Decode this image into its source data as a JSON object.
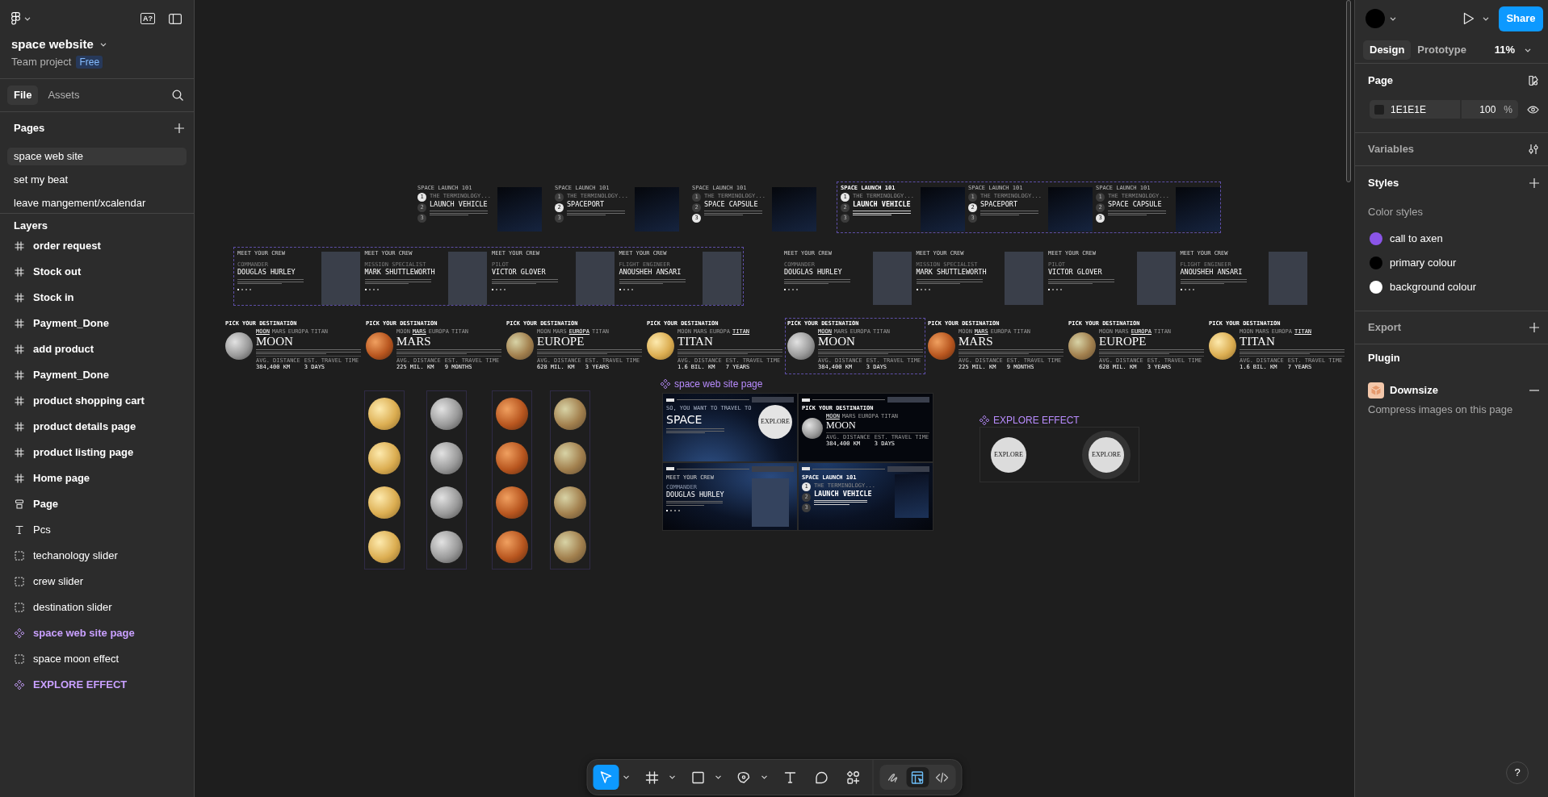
{
  "header": {
    "ai_label": "A?",
    "file_name": "space website",
    "project": "Team project",
    "plan": "Free"
  },
  "left_tabs": [
    {
      "label": "File",
      "selected": true
    },
    {
      "label": "Assets",
      "selected": false
    }
  ],
  "pages": {
    "title": "Pages",
    "items": [
      {
        "label": "space web site",
        "selected": true
      },
      {
        "label": "set my beat",
        "selected": false
      },
      {
        "label": "leave mangement/xcalendar",
        "selected": false
      }
    ]
  },
  "layers": {
    "title": "Layers",
    "items": [
      {
        "kind": "frame",
        "label": "order request"
      },
      {
        "kind": "frame",
        "label": "Stock out"
      },
      {
        "kind": "frame",
        "label": "Stock in"
      },
      {
        "kind": "frame",
        "label": "Payment_Done"
      },
      {
        "kind": "frame",
        "label": "add product"
      },
      {
        "kind": "frame",
        "label": "Payment_Done"
      },
      {
        "kind": "frame",
        "label": "product shopping cart"
      },
      {
        "kind": "frame",
        "label": "product details page"
      },
      {
        "kind": "frame",
        "label": "product listing page"
      },
      {
        "kind": "frame",
        "label": "Home page"
      },
      {
        "kind": "section",
        "label": "Page"
      },
      {
        "kind": "text",
        "label": "Pcs"
      },
      {
        "kind": "group",
        "label": "techanology slider"
      },
      {
        "kind": "group",
        "label": "crew slider"
      },
      {
        "kind": "group",
        "label": "destination slider"
      },
      {
        "kind": "component",
        "label": "space web site page"
      },
      {
        "kind": "group",
        "label": "space moon effect"
      },
      {
        "kind": "component",
        "label": "EXPLORE EFFECT"
      }
    ]
  },
  "canvas": {
    "tech_slider": {
      "groups": [
        {
          "slides": [
            {
              "heading": "SPACE LAUNCH 101",
              "eyebrow": "THE TERMINOLOGY...",
              "title": "LAUNCH VEHICLE",
              "steps": [
                {
                  "label": "1",
                  "selected": true
                },
                {
                  "label": "2",
                  "selected": false
                },
                {
                  "label": "3",
                  "selected": false
                }
              ]
            },
            {
              "heading": "SPACE LAUNCH 101",
              "eyebrow": "THE TERMINOLOGY...",
              "title": "SPACEPORT",
              "steps": [
                {
                  "label": "1",
                  "selected": false
                },
                {
                  "label": "2",
                  "selected": true
                },
                {
                  "label": "3",
                  "selected": false
                }
              ]
            },
            {
              "heading": "SPACE LAUNCH 101",
              "eyebrow": "THE TERMINOLOGY...",
              "title": "SPACE CAPSULE",
              "steps": [
                {
                  "label": "1",
                  "selected": false
                },
                {
                  "label": "2",
                  "selected": false
                },
                {
                  "label": "3",
                  "selected": true
                }
              ]
            }
          ]
        },
        {
          "outlined": true,
          "slides": [
            {
              "heading": "SPACE LAUNCH 101",
              "eyebrow": "THE TERMINOLOGY...",
              "title": "LAUNCH VEHICLE",
              "bold": true,
              "steps": [
                {
                  "label": "1",
                  "selected": true
                },
                {
                  "label": "2",
                  "selected": false
                },
                {
                  "label": "3",
                  "selected": false
                }
              ]
            },
            {
              "heading": "SPACE LAUNCH 101",
              "eyebrow": "THE TERMINOLOGY...",
              "title": "SPACEPORT",
              "steps": [
                {
                  "label": "1",
                  "selected": false
                },
                {
                  "label": "2",
                  "selected": true
                },
                {
                  "label": "3",
                  "selected": false
                }
              ]
            },
            {
              "heading": "SPACE LAUNCH 101",
              "eyebrow": "THE TERMINOLOGY...",
              "title": "SPACE CAPSULE",
              "steps": [
                {
                  "label": "1",
                  "selected": false
                },
                {
                  "label": "2",
                  "selected": false
                },
                {
                  "label": "3",
                  "selected": true
                }
              ]
            }
          ]
        }
      ]
    },
    "crew_slider": {
      "groups": [
        {
          "outlined": true,
          "cards": [
            {
              "heading": "MEET YOUR CREW",
              "role": "COMMANDER",
              "name": "DOUGLAS HURLEY"
            },
            {
              "heading": "MEET YOUR CREW",
              "role": "MISSION SPECIALIST",
              "name": "MARK SHUTTLEWORTH"
            },
            {
              "heading": "MEET YOUR CREW",
              "role": "PILOT",
              "name": "VICTOR GLOVER"
            },
            {
              "heading": "MEET YOUR CREW",
              "role": "FLIGHT ENGINEER",
              "name": "ANOUSHEH ANSARI"
            }
          ]
        },
        {
          "cards": [
            {
              "heading": "MEET YOUR CREW",
              "role": "COMMANDER",
              "name": "DOUGLAS HURLEY"
            },
            {
              "heading": "MEET YOUR CREW",
              "role": "MISSION SPECIALIST",
              "name": "MARK SHUTTLEWORTH"
            },
            {
              "heading": "MEET YOUR CREW",
              "role": "PILOT",
              "name": "VICTOR GLOVER"
            },
            {
              "heading": "MEET YOUR CREW",
              "role": "FLIGHT ENGINEER",
              "name": "ANOUSHEH ANSARI"
            }
          ]
        }
      ]
    },
    "destination_slider": {
      "frames": [
        {
          "heading": "PICK YOUR DESTINATION",
          "planet": {
            "kind": "moon"
          },
          "tabs": [
            {
              "label": "MOON",
              "selected": true
            },
            {
              "label": "MARS",
              "selected": false
            },
            {
              "label": "EUROPA",
              "selected": false
            },
            {
              "label": "TITAN",
              "selected": false
            }
          ],
          "title": "MOON",
          "stats": [
            {
              "label": "AVG. DISTANCE",
              "value": "384,400 KM"
            },
            {
              "label": "EST. TRAVEL TIME",
              "value": "3 DAYS"
            }
          ]
        },
        {
          "heading": "PICK YOUR DESTINATION",
          "planet": {
            "kind": "mars"
          },
          "tabs": [
            {
              "label": "MOON",
              "selected": false
            },
            {
              "label": "MARS",
              "selected": true
            },
            {
              "label": "EUROPA",
              "selected": false
            },
            {
              "label": "TITAN",
              "selected": false
            }
          ],
          "title": "MARS",
          "stats": [
            {
              "label": "AVG. DISTANCE",
              "value": "225 MIL. KM"
            },
            {
              "label": "EST. TRAVEL TIME",
              "value": "9 MONTHS"
            }
          ]
        },
        {
          "heading": "PICK YOUR DESTINATION",
          "planet": {
            "kind": "europa"
          },
          "tabs": [
            {
              "label": "MOON",
              "selected": false
            },
            {
              "label": "MARS",
              "selected": false
            },
            {
              "label": "EUROPA",
              "selected": true
            },
            {
              "label": "TITAN",
              "selected": false
            }
          ],
          "title": "EUROPE",
          "stats": [
            {
              "label": "AVG. DISTANCE",
              "value": "628 MIL. KM"
            },
            {
              "label": "EST. TRAVEL TIME",
              "value": "3 YEARS"
            }
          ]
        },
        {
          "heading": "PICK YOUR DESTINATION",
          "planet": {
            "kind": "titan"
          },
          "tabs": [
            {
              "label": "MOON",
              "selected": false
            },
            {
              "label": "MARS",
              "selected": false
            },
            {
              "label": "EUROPA",
              "selected": false
            },
            {
              "label": "TITAN",
              "selected": true
            }
          ],
          "title": "TITAN",
          "stats": [
            {
              "label": "AVG. DISTANCE",
              "value": "1.6 BIL. KM"
            },
            {
              "label": "EST. TRAVEL TIME",
              "value": "7 YEARS"
            }
          ]
        },
        {
          "outlined": true,
          "heading": "PICK YOUR DESTINATION",
          "planet": {
            "kind": "moon"
          },
          "tabs": [
            {
              "label": "MOON",
              "selected": true
            },
            {
              "label": "MARS",
              "selected": false
            },
            {
              "label": "EUROPA",
              "selected": false
            },
            {
              "label": "TITAN",
              "selected": false
            }
          ],
          "title": "MOON",
          "stats": [
            {
              "label": "AVG. DISTANCE",
              "value": "384,400 KM"
            },
            {
              "label": "EST. TRAVEL TIME",
              "value": "3 DAYS"
            }
          ]
        },
        {
          "heading": "PICK YOUR DESTINATION",
          "planet": {
            "kind": "mars"
          },
          "tabs": [
            {
              "label": "MOON",
              "selected": false
            },
            {
              "label": "MARS",
              "selected": true
            },
            {
              "label": "EUROPA",
              "selected": false
            },
            {
              "label": "TITAN",
              "selected": false
            }
          ],
          "title": "MARS",
          "stats": [
            {
              "label": "AVG. DISTANCE",
              "value": "225 MIL. KM"
            },
            {
              "label": "EST. TRAVEL TIME",
              "value": "9 MONTHS"
            }
          ]
        },
        {
          "heading": "PICK YOUR DESTINATION",
          "planet": {
            "kind": "europa"
          },
          "tabs": [
            {
              "label": "MOON",
              "selected": false
            },
            {
              "label": "MARS",
              "selected": false
            },
            {
              "label": "EUROPA",
              "selected": true
            },
            {
              "label": "TITAN",
              "selected": false
            }
          ],
          "title": "EUROPE",
          "stats": [
            {
              "label": "AVG. DISTANCE",
              "value": "628 MIL. KM"
            },
            {
              "label": "EST. TRAVEL TIME",
              "value": "3 YEARS"
            }
          ]
        },
        {
          "heading": "PICK YOUR DESTINATION",
          "planet": {
            "kind": "titan"
          },
          "tabs": [
            {
              "label": "MOON",
              "selected": false
            },
            {
              "label": "MARS",
              "selected": false
            },
            {
              "label": "EUROPA",
              "selected": false
            },
            {
              "label": "TITAN",
              "selected": true
            }
          ],
          "title": "TITAN",
          "stats": [
            {
              "label": "AVG. DISTANCE",
              "value": "1.6 BIL. KM"
            },
            {
              "label": "EST. TRAVEL TIME",
              "value": "7 YEARS"
            }
          ]
        }
      ]
    },
    "moon_effect": {
      "columns": [
        {
          "planets": [
            {
              "kind": "titan"
            },
            {
              "kind": "titan"
            },
            {
              "kind": "titan"
            },
            {
              "kind": "titan"
            }
          ]
        },
        {
          "planets": [
            {
              "kind": "moon"
            },
            {
              "kind": "moon"
            },
            {
              "kind": "moon"
            },
            {
              "kind": "moon"
            }
          ]
        },
        {
          "planets": [
            {
              "kind": "mars"
            },
            {
              "kind": "mars"
            },
            {
              "kind": "mars"
            },
            {
              "kind": "mars"
            }
          ]
        },
        {
          "planets": [
            {
              "kind": "europa"
            },
            {
              "kind": "europa"
            },
            {
              "kind": "europa"
            },
            {
              "kind": "europa"
            }
          ]
        }
      ]
    },
    "component": {
      "label": "space web site page",
      "screens": [
        {
          "kind": "home",
          "eyebrow": "SO, YOU WANT TO TRAVEL TO",
          "title": "SPACE",
          "button": "EXPLORE"
        },
        {
          "kind": "destination",
          "heading": "PICK YOUR DESTINATION",
          "planet": {
            "kind": "moon"
          },
          "tabs": [
            {
              "label": "MOON",
              "selected": true
            },
            {
              "label": "MARS",
              "selected": false
            },
            {
              "label": "EUROPA",
              "selected": false
            },
            {
              "label": "TITAN",
              "selected": false
            }
          ],
          "title": "MOON",
          "stats": [
            {
              "label": "AVG. DISTANCE",
              "value": "384,400 KM"
            },
            {
              "label": "EST. TRAVEL TIME",
              "value": "3 DAYS"
            }
          ]
        },
        {
          "kind": "crew",
          "heading": "MEET YOUR CREW",
          "role": "COMMANDER",
          "name": "DOUGLAS HURLEY"
        },
        {
          "kind": "technology",
          "heading": "SPACE LAUNCH 101",
          "eyebrow": "THE TERMINOLOGY...",
          "title": "LAUNCH VEHICLE",
          "steps": [
            {
              "label": "1",
              "selected": true
            },
            {
              "label": "2",
              "selected": false
            },
            {
              "label": "3",
              "selected": false
            }
          ]
        }
      ]
    },
    "explore_effect": {
      "label": "EXPLORE EFFECT",
      "buttons": [
        {
          "label": "EXPLORE"
        },
        {
          "label": "EXPLORE",
          "hover": true
        }
      ]
    }
  },
  "tools": [
    {
      "kind": "move",
      "selected": true,
      "menu": true
    },
    {
      "kind": "frame",
      "selected": false,
      "menu": true
    },
    {
      "kind": "shape",
      "selected": false,
      "menu": true
    },
    {
      "kind": "pen",
      "selected": false,
      "menu": true
    },
    {
      "kind": "text",
      "selected": false
    },
    {
      "kind": "comment",
      "selected": false
    },
    {
      "kind": "actions",
      "selected": false
    }
  ],
  "modes": [
    {
      "kind": "draw",
      "selected": false
    },
    {
      "kind": "design",
      "selected": true
    },
    {
      "kind": "dev",
      "selected": false
    }
  ],
  "panel": {
    "share": "Share",
    "tabs": [
      {
        "label": "Design",
        "selected": true
      },
      {
        "label": "Prototype",
        "selected": false
      }
    ],
    "zoom": "11%",
    "page": {
      "title": "Page",
      "fill": "1E1E1E",
      "opacity": "100",
      "unit": "%"
    },
    "variables": "Variables",
    "styles": {
      "title": "Styles",
      "group": "Color styles",
      "items": [
        {
          "label": "call to axen",
          "color": "#8b55e8"
        },
        {
          "label": "primary colour",
          "color": "#000000"
        },
        {
          "label": "background colour",
          "color": "#ffffff"
        }
      ]
    },
    "export": "Export",
    "plugin": {
      "title": "Plugin",
      "name": "Downsize",
      "description": "Compress images on this page"
    }
  },
  "help": "?"
}
